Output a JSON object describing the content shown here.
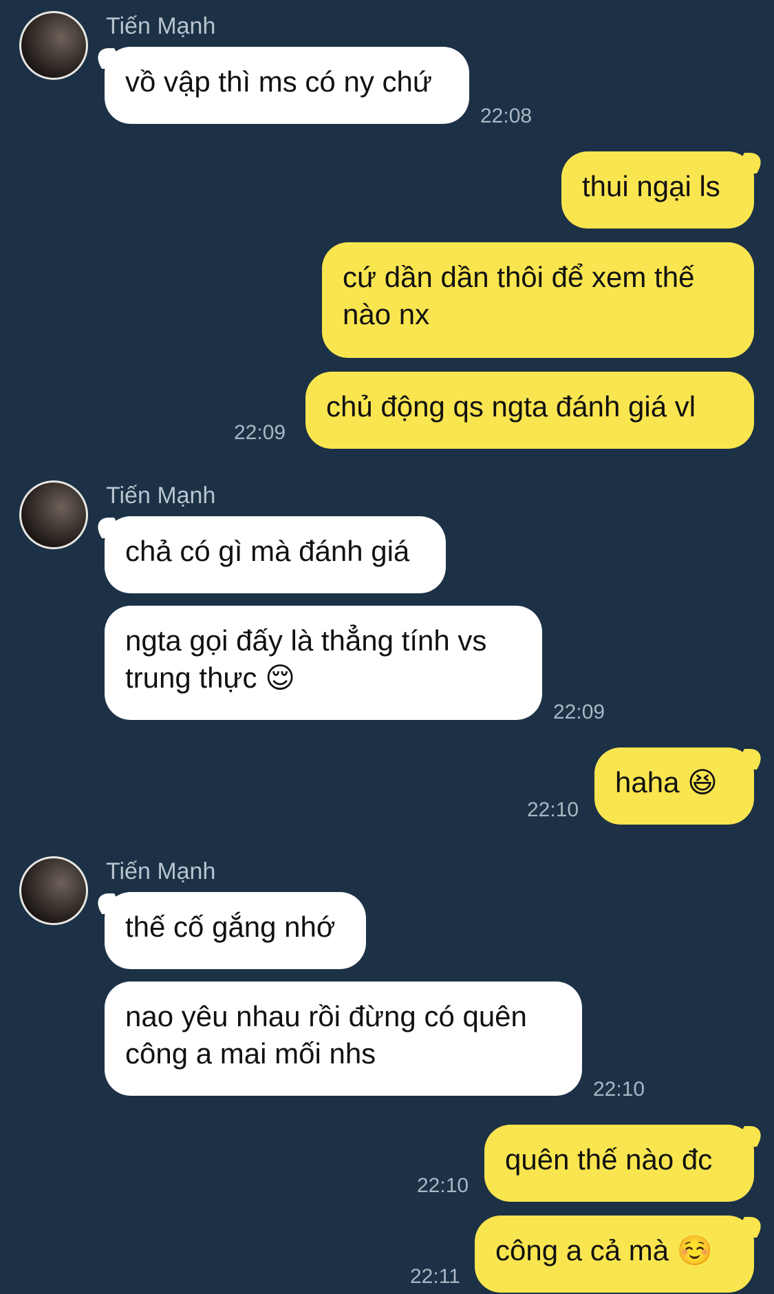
{
  "colors": {
    "background": "#1c3146",
    "incoming_bubble": "#ffffff",
    "outgoing_bubble": "#f9e54f",
    "timestamp": "#aab7c3",
    "sender_name": "#b8c4cf"
  },
  "contact": {
    "name": "Tiến Mạnh"
  },
  "messages": [
    {
      "direction": "in",
      "text": "vồ vập thì ms có ny chứ",
      "time": "22:08"
    },
    {
      "direction": "out",
      "text": "thui ngại ls"
    },
    {
      "direction": "out",
      "text": "cứ dần dần thôi để xem thế nào nx"
    },
    {
      "direction": "out",
      "text": "chủ động qs ngta đánh giá vl",
      "time": "22:09"
    },
    {
      "direction": "in",
      "text": "chả có gì mà đánh giá"
    },
    {
      "direction": "in",
      "text": "ngta gọi đấy là thẳng tính vs trung thực",
      "emoji": "😌",
      "time": "22:09"
    },
    {
      "direction": "out",
      "text": "haha",
      "emoji": "😆",
      "time": "22:10"
    },
    {
      "direction": "in",
      "text": "thế cố gắng nhớ"
    },
    {
      "direction": "in",
      "text": "nao yêu nhau rồi đừng có quên công a mai mối nhs",
      "time": "22:10"
    },
    {
      "direction": "out",
      "text": "quên thế nào đc",
      "time": "22:10"
    },
    {
      "direction": "out",
      "text": "công a cả mà",
      "emoji": "☺️",
      "time": "22:11"
    }
  ]
}
